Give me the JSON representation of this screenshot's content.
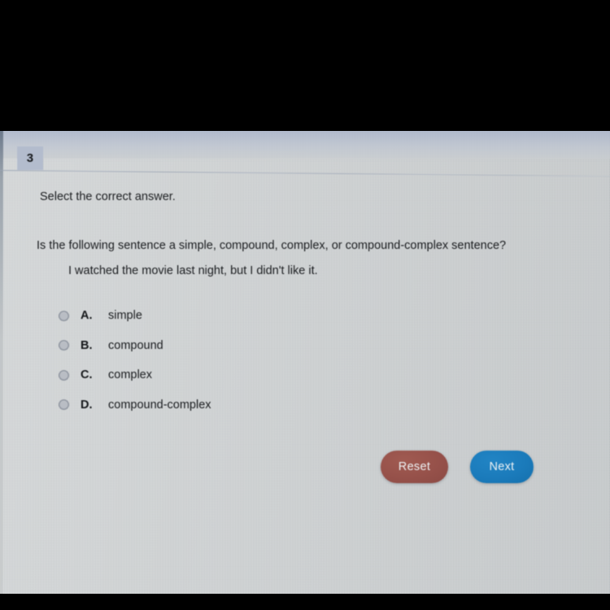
{
  "screen": {
    "question_number": "3",
    "prompt": "Select the correct answer.",
    "question": "Is the following sentence a simple, compound, complex, or compound-complex sentence?",
    "sentence": "I watched the movie last night, but I didn't like it.",
    "options": [
      {
        "letter": "A.",
        "text": "simple",
        "selected": false
      },
      {
        "letter": "B.",
        "text": "compound",
        "selected": false
      },
      {
        "letter": "C.",
        "text": "complex",
        "selected": false
      },
      {
        "letter": "D.",
        "text": "compound-complex",
        "selected": false
      }
    ],
    "buttons": {
      "reset_label": "Reset",
      "next_label": "Next"
    }
  },
  "colors": {
    "letterbox": "#000000",
    "screen_background": "#cdd0d0",
    "question_tab": "#b3bccd",
    "text": "#1b1d20",
    "radio_fill": "#b9bdc4",
    "radio_ring": "#9298a2",
    "reset_button": "#96514a",
    "next_button": "#1b7bbb",
    "button_label": "#eef2f4"
  }
}
